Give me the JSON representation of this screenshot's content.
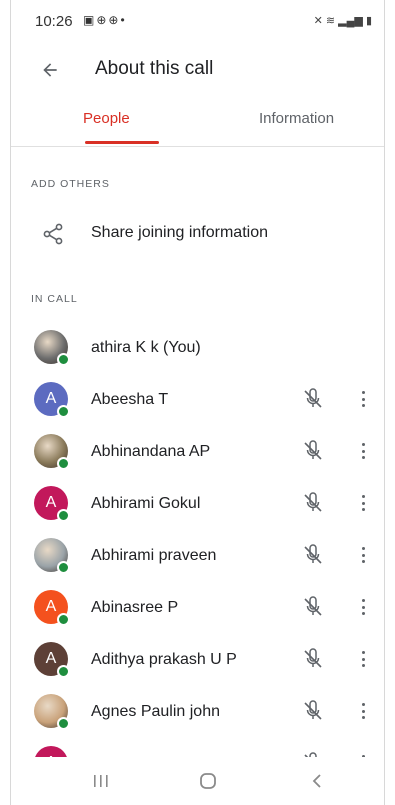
{
  "status_bar": {
    "time": "10:26",
    "left_icons": [
      "image-icon",
      "settings-icon",
      "settings-icon",
      "dot-icon"
    ],
    "right_icons": [
      "mute-icon",
      "wifi-icon",
      "volte-icon",
      "signal-icon",
      "battery-icon"
    ]
  },
  "header": {
    "title": "About this call",
    "back_icon": "arrow-back-icon"
  },
  "tabs": [
    {
      "label": "People",
      "active": true
    },
    {
      "label": "Information",
      "active": false
    }
  ],
  "add_others": {
    "section_label": "ADD OTHERS",
    "share_label": "Share joining information",
    "share_icon": "share-icon"
  },
  "in_call": {
    "section_label": "IN CALL",
    "participants": [
      {
        "name": "athira K k (You)",
        "initial": "",
        "avatar_color": "#6d6d6d",
        "photo": true,
        "show_actions": false
      },
      {
        "name": "Abeesha T",
        "initial": "A",
        "avatar_color": "#5c6bc0",
        "photo": false,
        "show_actions": true
      },
      {
        "name": "Abhinandana AP",
        "initial": "",
        "avatar_color": "#8a7a5a",
        "photo": true,
        "show_actions": true
      },
      {
        "name": "Abhirami Gokul",
        "initial": "A",
        "avatar_color": "#c2185b",
        "photo": false,
        "show_actions": true
      },
      {
        "name": "Abhirami praveen",
        "initial": "",
        "avatar_color": "#9aa3a8",
        "photo": true,
        "show_actions": true
      },
      {
        "name": "Abinasree P",
        "initial": "A",
        "avatar_color": "#f4511e",
        "photo": false,
        "show_actions": true
      },
      {
        "name": "Adithya prakash U P",
        "initial": "A",
        "avatar_color": "#5d4037",
        "photo": false,
        "show_actions": true
      },
      {
        "name": "Agnes Paulin john",
        "initial": "",
        "avatar_color": "#c9a27a",
        "photo": true,
        "show_actions": true
      },
      {
        "name": "",
        "initial": "A",
        "avatar_color": "#c2185b",
        "photo": false,
        "show_actions": true
      }
    ]
  },
  "colors": {
    "accent": "#d93025",
    "text_primary": "#202124",
    "text_secondary": "#5f6368",
    "online": "#1e8e3e"
  }
}
